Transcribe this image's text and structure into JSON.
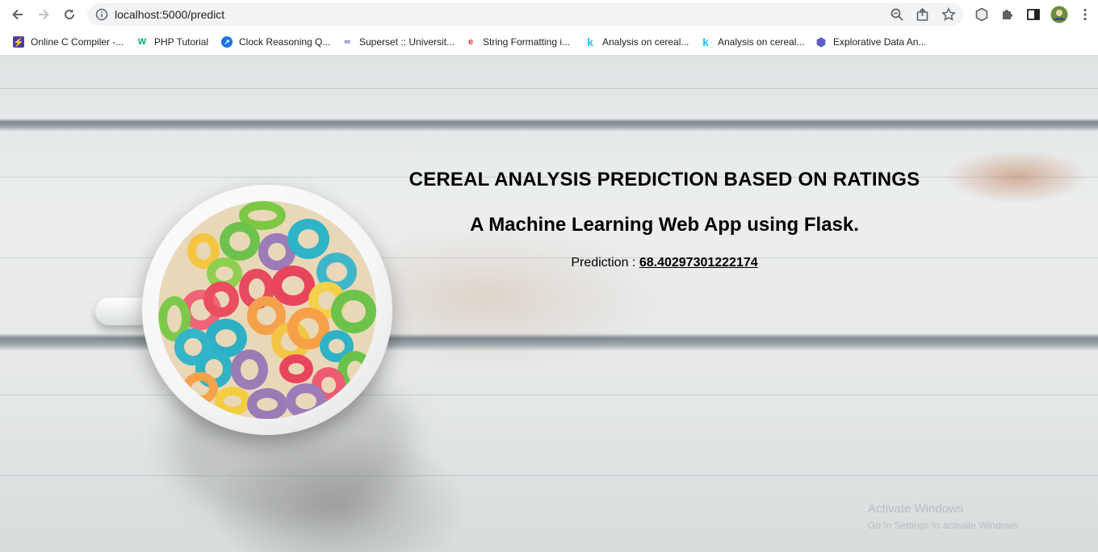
{
  "browser": {
    "url": "localhost:5000/predict",
    "bookmarks": [
      {
        "label": "Online C Compiler -...",
        "icon": "lightning-icon",
        "color": "#4b3f9e"
      },
      {
        "label": "PHP Tutorial",
        "icon": "w3schools-icon",
        "color": "#04aa6d"
      },
      {
        "label": "Clock Reasoning Q...",
        "icon": "circle-logo-icon",
        "color": "#1a73e8"
      },
      {
        "label": "Superset :: Universit...",
        "icon": "superset-icon",
        "color": "#5c6bc0"
      },
      {
        "label": "String Formatting i...",
        "icon": "e-logo-icon",
        "color": "#e53935"
      },
      {
        "label": "Analysis on cereal...",
        "icon": "kaggle-icon",
        "color": "#20beff"
      },
      {
        "label": "Analysis on cereal...",
        "icon": "kaggle-icon",
        "color": "#20beff"
      },
      {
        "label": "Explorative Data An...",
        "icon": "hexagon-icon",
        "color": "#5b5fc7"
      }
    ]
  },
  "page": {
    "title": "CEREAL ANALYSIS PREDICTION BASED ON RATINGS",
    "subtitle": "A Machine Learning Web App using Flask.",
    "prediction_label": "Prediction :",
    "prediction_value": "68.40297301222174"
  },
  "watermark": {
    "line1": "Activate Windows",
    "line2": "Go to Settings to activate Windows."
  }
}
